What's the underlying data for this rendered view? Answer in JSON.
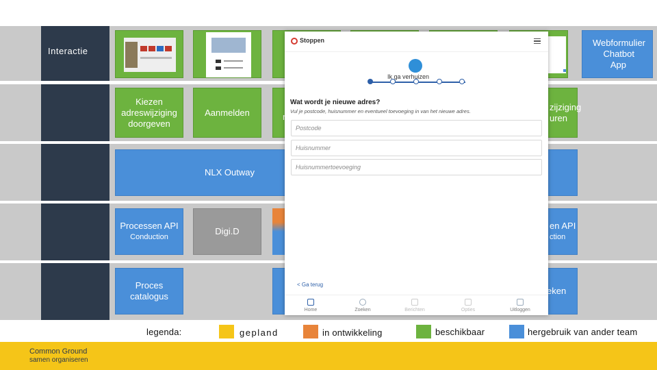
{
  "rows": {
    "interactie": "Interactie"
  },
  "tiles": {
    "kiezen": "Kiezen adreswijziging doorgeven",
    "aanmelden": "Aanmelden",
    "partial_m": "m",
    "adres_right": "zijziging",
    "adres_right2": "uren",
    "nlx": "NLX Outway",
    "processen_api": "Processen API",
    "conduction": "Conduction",
    "digid": "Digi.D",
    "processen_right": "en API",
    "conduction_right": "ction",
    "proces_catalogus": "Proces catalogus",
    "eken": "eken",
    "webformulier": "Webformulier",
    "chatbot": "Chatbot",
    "app": "App"
  },
  "legend": {
    "label": "legenda:",
    "gepland": "gepland",
    "ontwikkeling": "in ontwikkeling",
    "beschikbaar": "beschikbaar",
    "hergebruik": "hergebruik van ander team"
  },
  "colors": {
    "gepland": "#f5c518",
    "ontwikkeling": "#e8843a",
    "beschikbaar": "#6db33f",
    "hergebruik": "#4a8fd9",
    "footer": "#f5c518"
  },
  "footer": {
    "line1": "Common Ground",
    "line2": "samen organiseren"
  },
  "phone": {
    "logo": "Stoppen",
    "menu_icon": "hamburger-icon",
    "step_title": "Ik ga verhuizen",
    "question": "Wat wordt je nieuwe adres?",
    "hint": "Vul je postcode, huisnummer en eventueel toevoeging in van het nieuwe adres.",
    "postcode_placeholder": "Postcode",
    "huisnummer_placeholder": "Huisnummer",
    "toevoeging_placeholder": "Huisnummertoevoeging",
    "back": "< Ga terug",
    "nav": [
      "Home",
      "Zoeken",
      "Berichten",
      "Opties",
      "Uitloggen"
    ]
  }
}
